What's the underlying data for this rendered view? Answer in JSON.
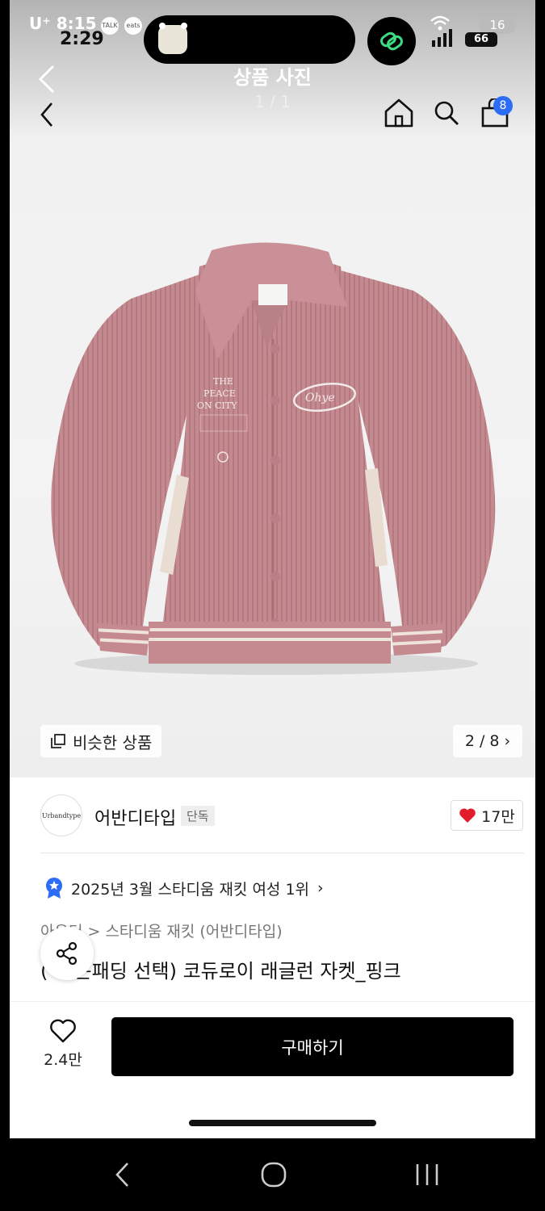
{
  "status_bar": {
    "carrier": "U⁺ 8:15",
    "time": "2:29",
    "badge_talk": "TALK",
    "badge_eats": "eats",
    "battery": "66",
    "battery_top": "16"
  },
  "overlay": {
    "title": "상품 사진",
    "counter": "1 / 1"
  },
  "header": {
    "cart_count": "8"
  },
  "image_area": {
    "similar_label": "비슷한 상품",
    "pager": "2 / 8"
  },
  "seller": {
    "logo_text": "Urbandtype",
    "name": "어반디타입",
    "exclusive": "단독",
    "likes": "17만"
  },
  "product": {
    "rank": "2025년 3월 스타디움 재킷 여성 1위",
    "breadcrumb": "아우터 > 스타디움 재킷 (어반디타입)",
    "name": "(   or논패딩 선택) 코듀로이 래글런 자켓_핑크"
  },
  "bottom_bar": {
    "wish_count": "2.4만",
    "buy_label": "구매하기"
  },
  "colors": {
    "accent_blue": "#2d6cf5",
    "heart_red": "#e11d2b",
    "jacket_pink": "#c48a8f"
  }
}
